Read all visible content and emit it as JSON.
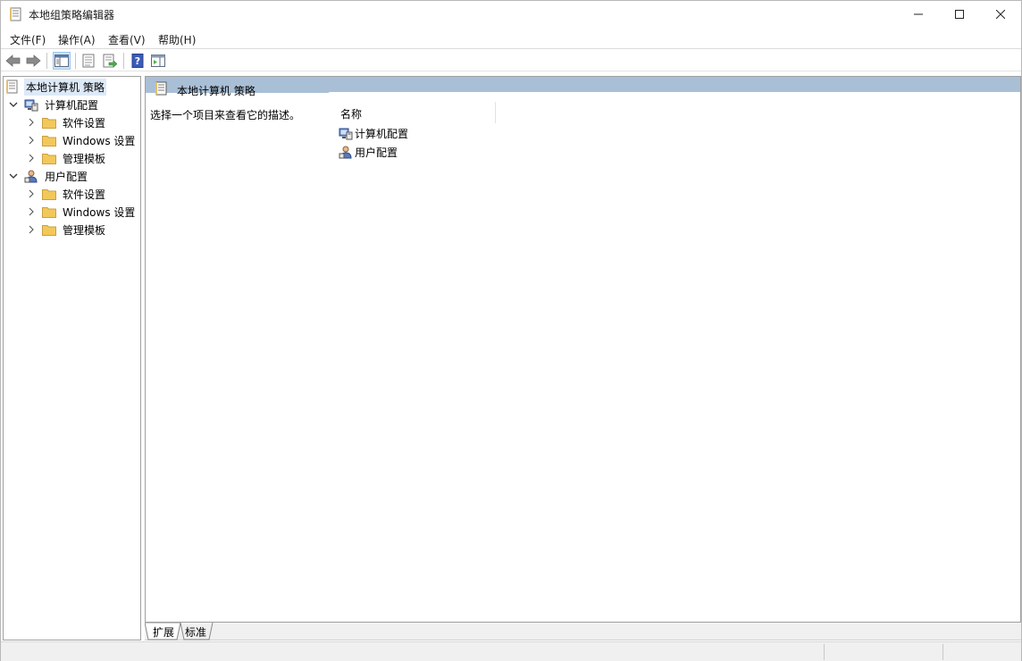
{
  "window": {
    "title": "本地组策略编辑器"
  },
  "menu": {
    "items": [
      {
        "label": "文件(F)"
      },
      {
        "label": "操作(A)"
      },
      {
        "label": "查看(V)"
      },
      {
        "label": "帮助(H)"
      }
    ]
  },
  "toolbar": {
    "buttons": [
      {
        "icon": "back-arrow-icon"
      },
      {
        "icon": "forward-arrow-icon"
      },
      {
        "icon": "show-hide-tree-icon"
      },
      {
        "icon": "properties-icon"
      },
      {
        "icon": "export-list-icon"
      },
      {
        "icon": "help-icon"
      },
      {
        "icon": "show-hide-action-pane-icon"
      }
    ]
  },
  "tree": {
    "root": "本地计算机 策略",
    "computer": {
      "label": "计算机配置",
      "children": [
        "软件设置",
        "Windows 设置",
        "管理模板"
      ]
    },
    "user": {
      "label": "用户配置",
      "children": [
        "软件设置",
        "Windows 设置",
        "管理模板"
      ]
    }
  },
  "content": {
    "header": "本地计算机 策略",
    "description": "选择一个项目来查看它的描述。",
    "column_name": "名称",
    "items": [
      "计算机配置",
      "用户配置"
    ]
  },
  "tabs": {
    "extended": "扩展",
    "standard": "标准"
  },
  "colors": {
    "pane_header": "#a9bfd6",
    "selection": "#dde9f7",
    "folder": "#f3c85a"
  }
}
